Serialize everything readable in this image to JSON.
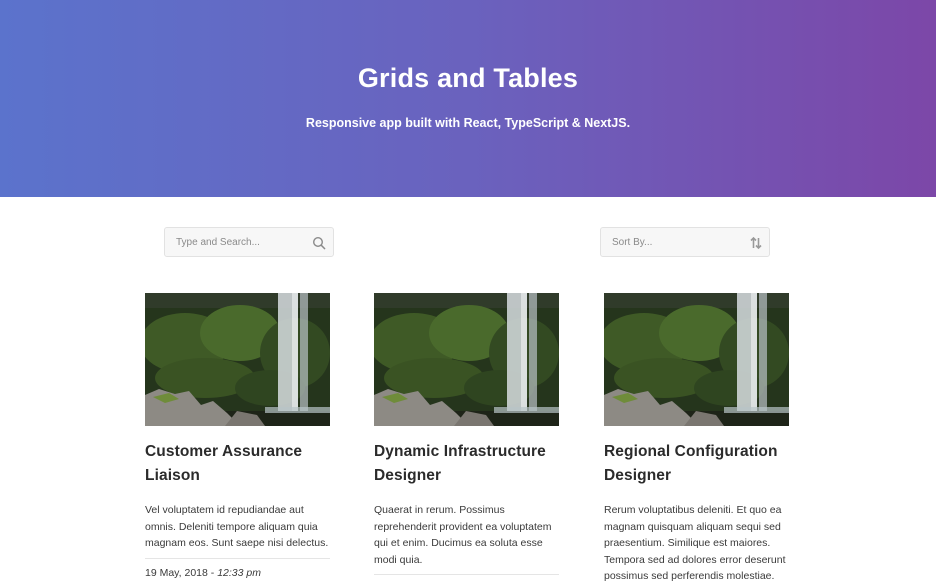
{
  "hero": {
    "title": "Grids and Tables",
    "subtitle": "Responsive app built with React, TypeScript & NextJS."
  },
  "search": {
    "placeholder": "Type and Search...",
    "value": "",
    "icon": "search-icon"
  },
  "sort": {
    "label": "Sort By...",
    "icon": "sort-arrows-icon"
  },
  "cards": [
    {
      "title": "Customer Assurance Liaison",
      "description": "Vel voluptatem id repudiandae aut omnis. Deleniti tempore aliquam quia magnam eos. Sunt saepe nisi delectus.",
      "date": "19 May, 2018",
      "date_separator": " - ",
      "time": "12:33 pm"
    },
    {
      "title": "Dynamic Infrastructure Designer",
      "description": "Quaerat in rerum. Possimus reprehenderit provident ea voluptatem qui et enim. Ducimus ea soluta esse modi quia.",
      "date": "",
      "date_separator": "",
      "time": ""
    },
    {
      "title": "Regional Configuration Designer",
      "description": "Rerum voluptatibus deleniti. Et quo ea magnam quisquam aliquam sequi sed praesentium. Similique est maiores. Tempora sed ad dolores error deserunt possimus sed perferendis molestiae.",
      "date": "",
      "date_separator": "",
      "time": ""
    }
  ],
  "colors": {
    "hero_gradient_start": "#5b73cc",
    "hero_gradient_end": "#7c47a8"
  }
}
